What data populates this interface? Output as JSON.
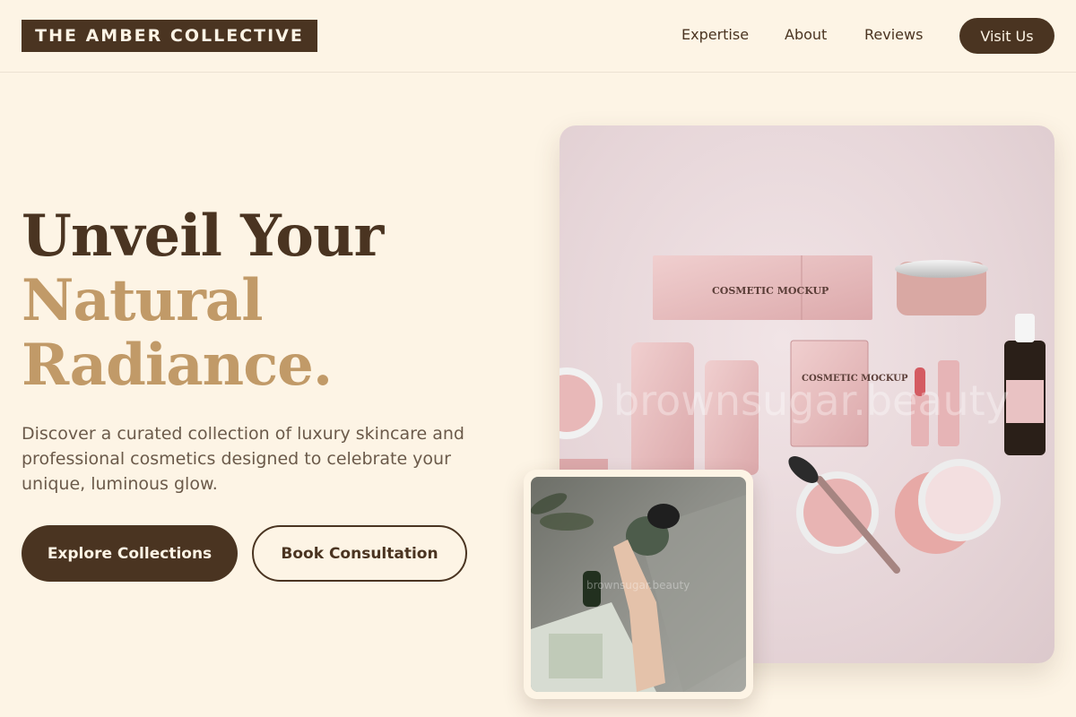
{
  "header": {
    "logo_text": "THE AMBER COLLECTIVE",
    "nav": {
      "expertise": "Expertise",
      "about": "About",
      "reviews": "Reviews"
    },
    "cta_label": "Visit Us"
  },
  "hero": {
    "title_line1": "Unveil Your",
    "title_line2": "Natural",
    "title_line3": "Radiance.",
    "description": "Discover a curated collection of luxury skincare and professional cosmetics designed to celebrate your unique, luminous glow.",
    "primary_button": "Explore Collections",
    "secondary_button": "Book Consultation"
  },
  "images": {
    "main_watermark": "brownsugar.beauty",
    "thumb_watermark": "brownsugar.beauty",
    "product_box_text": "COSMETIC MOCKUP",
    "sachet_text": "COSMETIC MOCKUP"
  },
  "colors": {
    "background": "#fdf4e5",
    "brand_dark": "#4a3421",
    "accent_gold": "#c19a68",
    "product_pink": "#e8bfc0"
  }
}
